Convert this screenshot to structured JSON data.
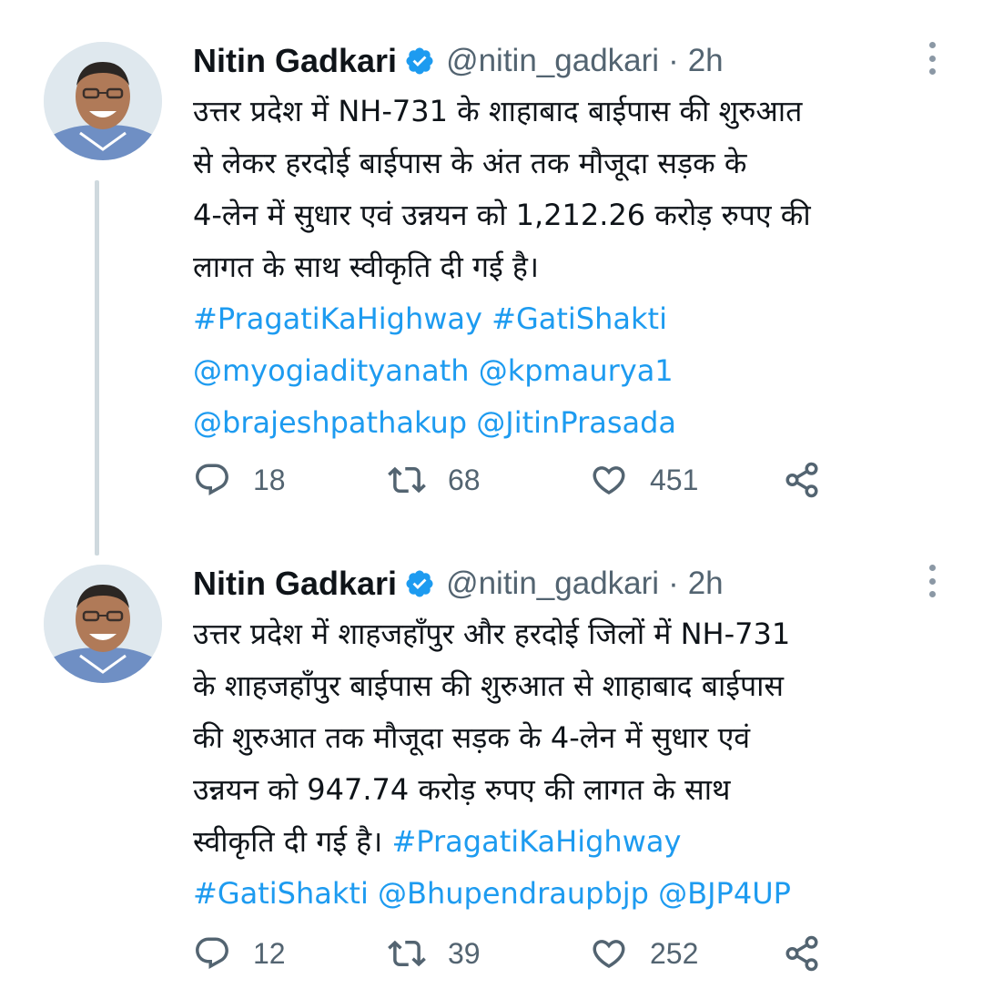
{
  "colors": {
    "accent": "#1d9bf0",
    "secondary_text": "#536471",
    "thread_line": "#cfd9de",
    "verified_badge": "#1d9bf0"
  },
  "tweets": [
    {
      "author": {
        "name": "Nitin Gadkari",
        "handle": "@nitin_gadkari",
        "verified": true,
        "avatar_icon": "profile-photo"
      },
      "separator": "·",
      "time": "2h",
      "lines": [
        [
          {
            "text": "उत्तर प्रदेश में NH-731 के शाहाबाद बाईपास की शुरुआत"
          }
        ],
        [
          {
            "text": "से लेकर हरदोई बाईपास के अंत तक मौजूदा सड़क के"
          }
        ],
        [
          {
            "text": "4-लेन में सुधार एवं उन्नयन को 1,212.26 करोड़ रुपए की"
          }
        ],
        [
          {
            "text": "लागत के साथ स्वीकृति दी गई है।"
          }
        ],
        [
          {
            "text": "#PragatiKaHighway",
            "link": true
          },
          {
            "text": " "
          },
          {
            "text": "#GatiShakti",
            "link": true
          }
        ],
        [
          {
            "text": "@myogiadityanath",
            "link": true
          },
          {
            "text": " "
          },
          {
            "text": "@kpmaurya1",
            "link": true
          }
        ],
        [
          {
            "text": "@brajeshpathakup",
            "link": true
          },
          {
            "text": " "
          },
          {
            "text": "@JitinPrasada",
            "link": true
          }
        ]
      ],
      "stats": {
        "replies": "18",
        "retweets": "68",
        "likes": "451"
      }
    },
    {
      "author": {
        "name": "Nitin Gadkari",
        "handle": "@nitin_gadkari",
        "verified": true,
        "avatar_icon": "profile-photo"
      },
      "separator": "·",
      "time": "2h",
      "lines": [
        [
          {
            "text": "उत्तर प्रदेश में शाहजहाँपुर और हरदोई जिलों में NH-731"
          }
        ],
        [
          {
            "text": "के शाहजहाँपुर बाईपास की शुरुआत से शाहाबाद बाईपास"
          }
        ],
        [
          {
            "text": "की शुरुआत तक मौजूदा सड़क के 4-लेन में सुधार एवं"
          }
        ],
        [
          {
            "text": "उन्नयन को 947.74 करोड़ रुपए की लागत के साथ"
          }
        ],
        [
          {
            "text": "स्वीकृति दी गई है। "
          },
          {
            "text": "#PragatiKaHighway",
            "link": true
          }
        ],
        [
          {
            "text": "#GatiShakti",
            "link": true
          },
          {
            "text": "  "
          },
          {
            "text": "@Bhupendraupbjp",
            "link": true
          },
          {
            "text": " "
          },
          {
            "text": "@BJP4UP",
            "link": true
          }
        ]
      ],
      "stats": {
        "replies": "12",
        "retweets": "39",
        "likes": "252"
      }
    }
  ],
  "icons": {
    "reply": "reply-icon",
    "retweet": "retweet-icon",
    "like": "heart-icon",
    "share": "share-icon",
    "more": "more-vertical-icon",
    "verified": "verified-badge-icon"
  }
}
